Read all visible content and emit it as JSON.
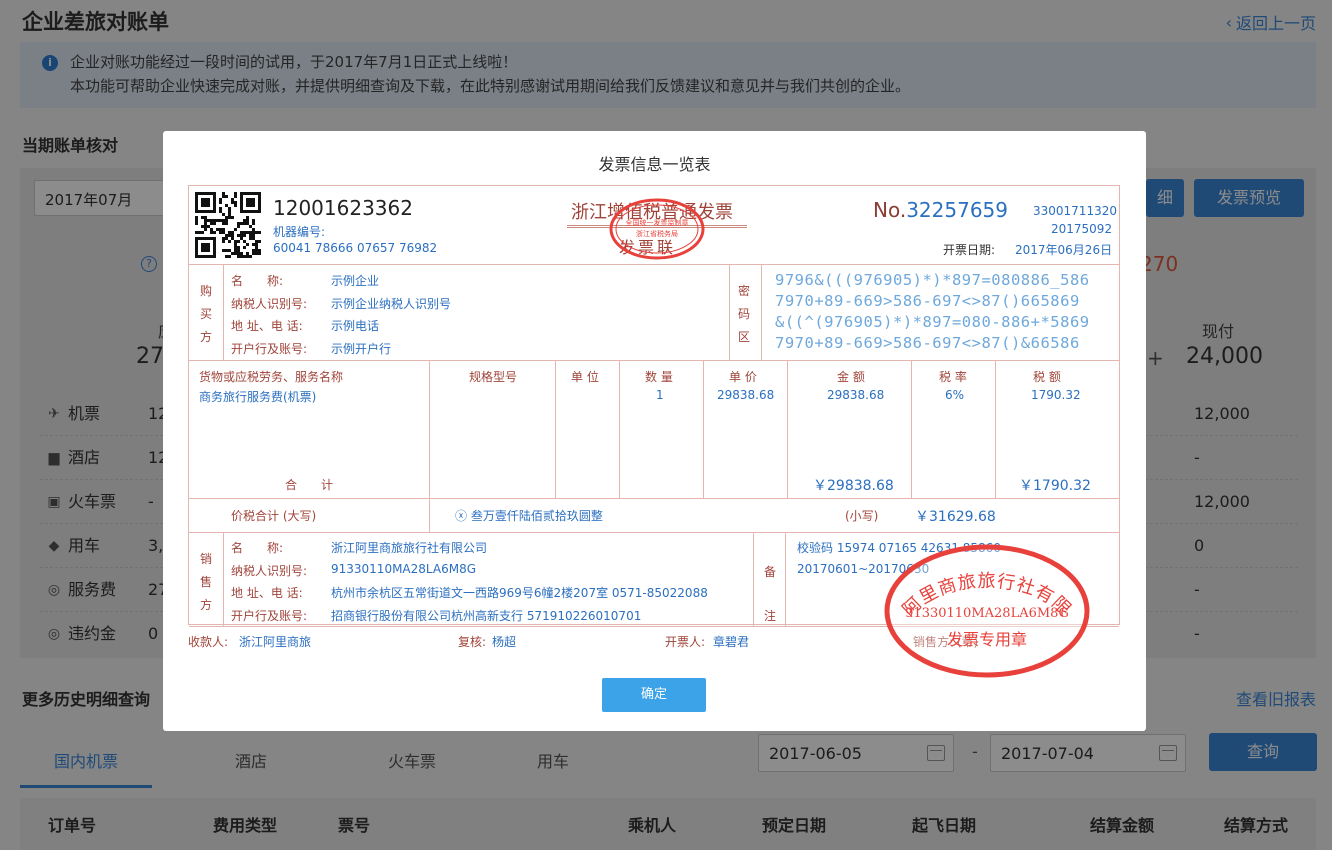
{
  "page": {
    "title": "企业差旅对账单",
    "back": "返回上一页"
  },
  "notice": {
    "line1": "企业对账功能经过一段时间的试用，于2017年7月1日正式上线啦！",
    "line2": "本功能可帮助企业快速完成对账，并提供明细查询及下载，在此特别感谢试用期间给我们反馈建议和意见并与我们共创的企业。"
  },
  "current": {
    "title": "当期账单核对",
    "month": "2017年07月",
    "btn_detail": "细",
    "btn_preview": "发票预览",
    "red_amount": "270",
    "sum_left": "27",
    "sum_left_label": "应",
    "cash_label": "现付",
    "cash_value": "24,000",
    "plus": "+",
    "rows": [
      {
        "icon": "plane",
        "label": "机票",
        "v1": "12",
        "v2": "12,000"
      },
      {
        "icon": "hotel",
        "label": "酒店",
        "v1": "12",
        "v2": "-"
      },
      {
        "icon": "train",
        "label": "火车票",
        "v1": "-",
        "v2": "12,000"
      },
      {
        "icon": "car",
        "label": "用车",
        "v1": "3,",
        "v2": "0"
      },
      {
        "icon": "coins",
        "label": "服务费",
        "v1": "27",
        "v2": "-"
      },
      {
        "icon": "coins",
        "label": "违约金",
        "v1": "0",
        "v2": "-"
      }
    ]
  },
  "history": {
    "title": "更多历史明细查询",
    "old_report": "查看旧报表",
    "tabs": [
      "国内机票",
      "酒店",
      "火车票",
      "用车"
    ],
    "date_from": "2017-06-05",
    "date_sep": "-",
    "date_to": "2017-07-04",
    "query": "查询",
    "columns": [
      "订单号",
      "费用类型",
      "票号",
      "乘机人",
      "预定日期",
      "起飞日期",
      "结算金额",
      "结算方式"
    ]
  },
  "modal": {
    "title": "发票信息一览表",
    "ok": "确定",
    "invoice": {
      "code": "12001623362",
      "machine_label": "机器编号:",
      "machine_no": "60041 78666 07657 76982",
      "title": "浙江增值税普通发票",
      "subtitle": "发票联",
      "no_label": "No.",
      "no": "32257659",
      "code2": "33001711320",
      "code3": "20175092",
      "date_label": "开票日期:",
      "date": "2017年06月26日",
      "buyer_side": "购买方",
      "cipher_side": "密码区",
      "buyer": [
        {
          "k": "名　　称:",
          "v": "示例企业"
        },
        {
          "k": "纳税人识别号:",
          "v": "示例企业纳税人识别号"
        },
        {
          "k": "地 址、电 话:",
          "v": "示例电话"
        },
        {
          "k": "开户行及账号:",
          "v": "示例开户行"
        }
      ],
      "cipher": [
        "9796&(((976905)*)*897=080886_586",
        "7970+89-669>586-697<>87()665869",
        "&((^(976905)*)*897=080-886+*5869",
        "7970+89-669>586-697<>87()&66586"
      ],
      "cols": {
        "name": "货物或应税劳务、服务名称",
        "spec": "规格型号",
        "unit": "单 位",
        "qty": "数 量",
        "price": "单 价",
        "amount": "金 额",
        "rate": "税 率",
        "tax": "税 额"
      },
      "item": {
        "name": "商务旅行服务费(机票)",
        "qty": "1",
        "price": "29838.68",
        "amount": "29838.68",
        "rate": "6%",
        "tax": "1790.32"
      },
      "total_label": "合　　计",
      "total_amount": "￥29838.68",
      "total_tax": "￥1790.32",
      "sum_label": "价税合计 (大写)",
      "sum_words": "ⓧ  叁万壹仟陆佰贰拾玖圆整",
      "small_label": "(小写)",
      "small": "￥31629.68",
      "seller_side": "销售方",
      "remark_side": "备注",
      "seller": [
        {
          "k": "名　　称:",
          "v": "浙江阿里商旅旅行社有限公司"
        },
        {
          "k": "纳税人识别号:",
          "v": "91330110MA28LA6M8G"
        },
        {
          "k": "地 址、电 话:",
          "v": "杭州市余杭区五常街道文一西路969号6幢2楼207室 0571-85022088"
        },
        {
          "k": "开户行及账号:",
          "v": "招商银行股份有限公司杭州高新支行 571910226010701"
        }
      ],
      "remark1": "校验码 15974 07165 42631 85860",
      "remark2": "20170601~20170630",
      "payee_label": "收款人:",
      "payee": "浙江阿里商旅",
      "review_label": "复核:",
      "review": "杨超",
      "issuer_label": "开票人:",
      "issuer": "章碧君",
      "sales_label": "销售方: (章)",
      "stamp_colour": "#e8413b"
    }
  }
}
